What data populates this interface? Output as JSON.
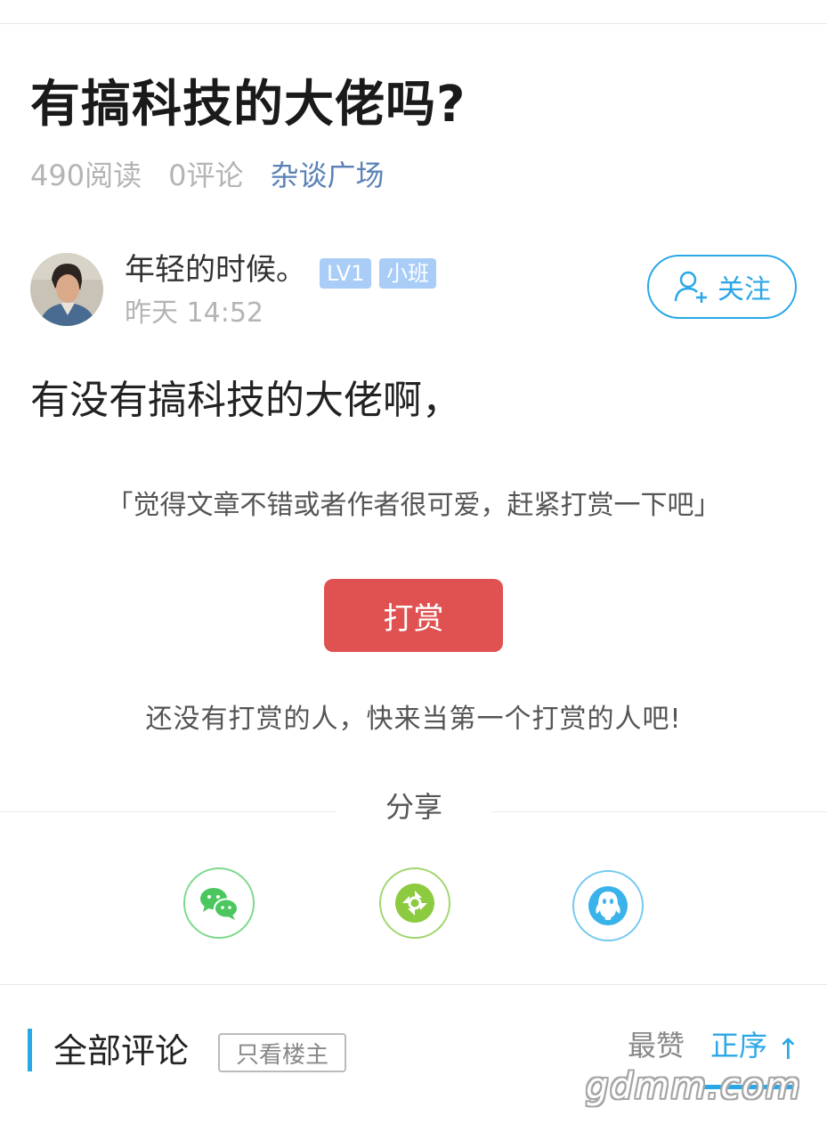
{
  "post": {
    "title": "有搞科技的大佬吗?",
    "reads": "490阅读",
    "comments": "0评论",
    "category": "杂谈广场",
    "body": "有没有搞科技的大佬啊，"
  },
  "author": {
    "name": "年轻的时候。",
    "level": "LV1",
    "rank": "小班",
    "time": "昨天 14:52",
    "follow_label": "关注"
  },
  "tip": {
    "prompt": "「觉得文章不错或者作者很可爱，赶紧打赏一下吧」",
    "button_label": "打赏",
    "empty_text": "还没有打赏的人，快来当第一个打赏的人吧!"
  },
  "share": {
    "title": "分享",
    "targets": [
      {
        "icon": "wechat-icon",
        "color": "#4cc75f"
      },
      {
        "icon": "moments-icon",
        "color": "#8ccb3f"
      },
      {
        "icon": "qq-icon",
        "color": "#39b3ea"
      }
    ]
  },
  "comments_section": {
    "title": "全部评论",
    "owner_only_label": "只看楼主",
    "sort_top": "最赞",
    "sort_order": "正序",
    "sort_arrow": "↑"
  },
  "watermark": "gdmm.com",
  "colors": {
    "accent": "#2aa7e6",
    "tip_button": "#e05252",
    "category_link": "#5a82b6",
    "badge": "#a9cdf6"
  }
}
